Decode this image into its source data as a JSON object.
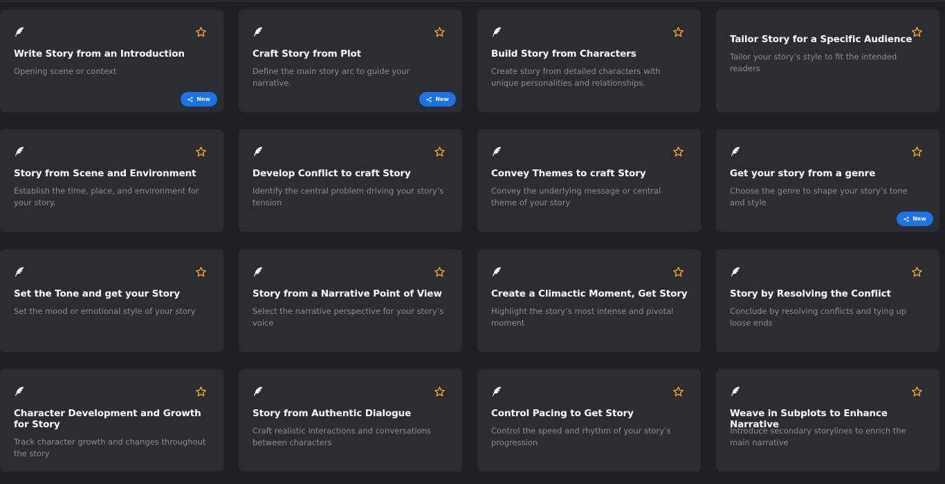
{
  "accent_colors": {
    "star": "#f5a623",
    "badge": "#1a73e8",
    "card_bg": "#2c2d33",
    "page_bg": "#1f2024"
  },
  "icons": {
    "card_icon": "feather-icon",
    "favorite": "star-outline-icon",
    "badge_icon": "sparkle-share-icon"
  },
  "cards": [
    {
      "title": "Write Story from an Introduction",
      "description": "Opening scene or context",
      "badge": "New"
    },
    {
      "title": "Craft Story from Plot",
      "description": "Define the main story arc to guide your narrative.",
      "badge": "New"
    },
    {
      "title": "Build Story from Characters",
      "description": "Create story from detailed characters with unique personalities and relationships.",
      "badge": null
    },
    {
      "title": "Tailor Story for a Specific Audience",
      "description": "Tailor your story’s style to fit the intended readers",
      "badge": null
    },
    {
      "title": "Story from Scene and Environment",
      "description": "Establish the time, place, and environment for your story.",
      "badge": null
    },
    {
      "title": "Develop Conflict to craft Story",
      "description": "Identify the central problem driving your story’s tension",
      "badge": null
    },
    {
      "title": "Convey Themes to craft Story",
      "description": "Convey the underlying message or central theme of your story",
      "badge": null
    },
    {
      "title": "Get your story from a genre",
      "description": "Choose the genre to shape your story’s tone and style",
      "badge": "New"
    },
    {
      "title": "Set the Tone and get your Story",
      "description": "Set the mood or emotional style of your story",
      "badge": null
    },
    {
      "title": "Story from a Narrative Point of View",
      "description": "Select the narrative perspective for your story’s voice",
      "badge": null
    },
    {
      "title": "Create a Climactic Moment, Get Story",
      "description": "Highlight the story’s most intense and pivotal moment",
      "badge": null
    },
    {
      "title": "Story by Resolving the Conflict",
      "description": "Conclude by resolving conflicts and tying up loose ends",
      "badge": null
    },
    {
      "title": "Character Development and Growth for Story",
      "description": "Track character growth and changes throughout the story",
      "badge": null
    },
    {
      "title": "Story from Authentic Dialogue",
      "description": "Craft realistic interactions and conversations between characters",
      "badge": null
    },
    {
      "title": "Control Pacing to Get Story",
      "description": "Control the speed and rhythm of your story’s progression",
      "badge": null
    },
    {
      "title": "Weave in Subplots to Enhance Narrative",
      "description": "Introduce secondary storylines to enrich the main narrative",
      "badge": null
    }
  ]
}
